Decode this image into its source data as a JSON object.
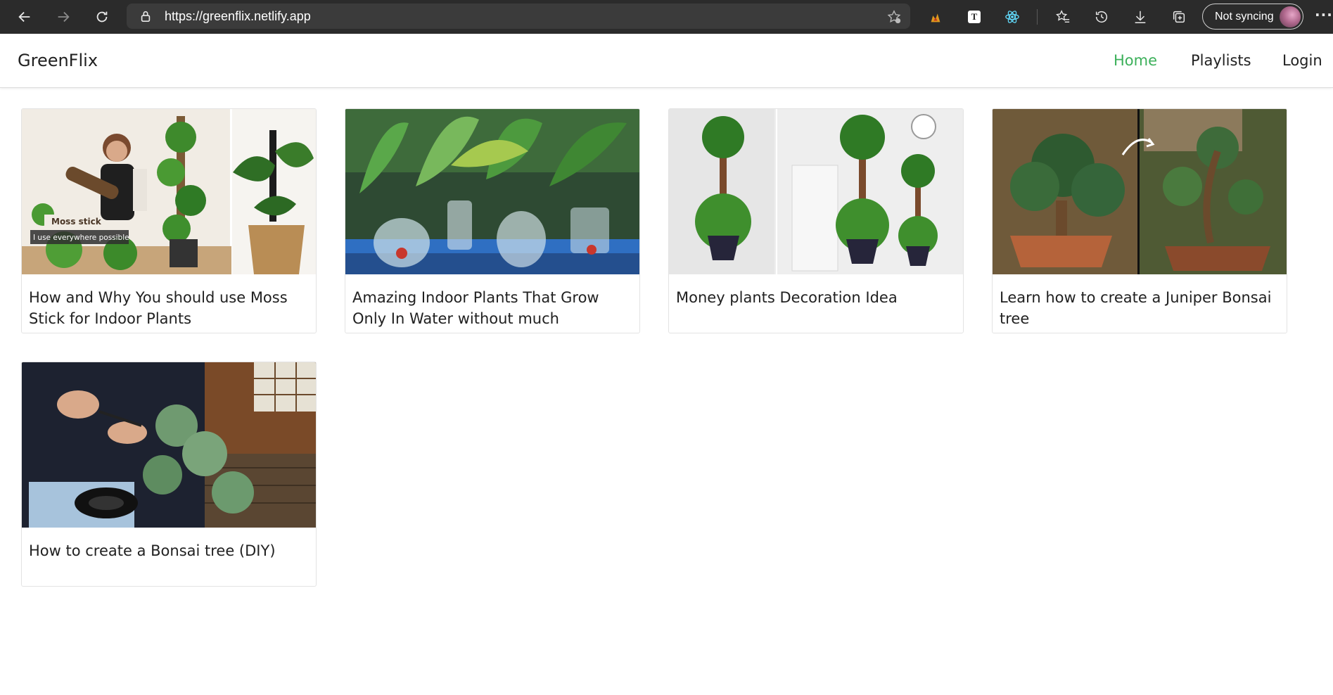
{
  "browser": {
    "url": "https://greenflix.netlify.app",
    "sync_label": "Not syncing",
    "more_label": "···",
    "toolbar_icons": [
      "back-icon",
      "forward-icon",
      "refresh-icon",
      "lock-icon",
      "add-favorite-icon",
      "extension-icon",
      "t-extension-icon",
      "react-devtools-icon",
      "favorites-icon",
      "history-icon",
      "download-icon",
      "collections-icon",
      "profile-avatar"
    ]
  },
  "app": {
    "brand": "GreenFlix",
    "nav": [
      {
        "label": "Home",
        "active": true
      },
      {
        "label": "Playlists",
        "active": false
      },
      {
        "label": "Login",
        "active": false
      }
    ],
    "accent_color": "#3cb05a"
  },
  "videos": [
    {
      "title": "How and Why You should use Moss Stick for Indoor Plants",
      "thumb_caption_1": "Moss stick",
      "thumb_caption_2": "I use everywhere possible"
    },
    {
      "title": "Amazing Indoor Plants That Grow Only In Water without much maintenance"
    },
    {
      "title": "Money plants Decoration Idea"
    },
    {
      "title": "Learn how to create a Juniper Bonsai tree"
    },
    {
      "title": "How to create a Bonsai tree (DIY)"
    }
  ]
}
